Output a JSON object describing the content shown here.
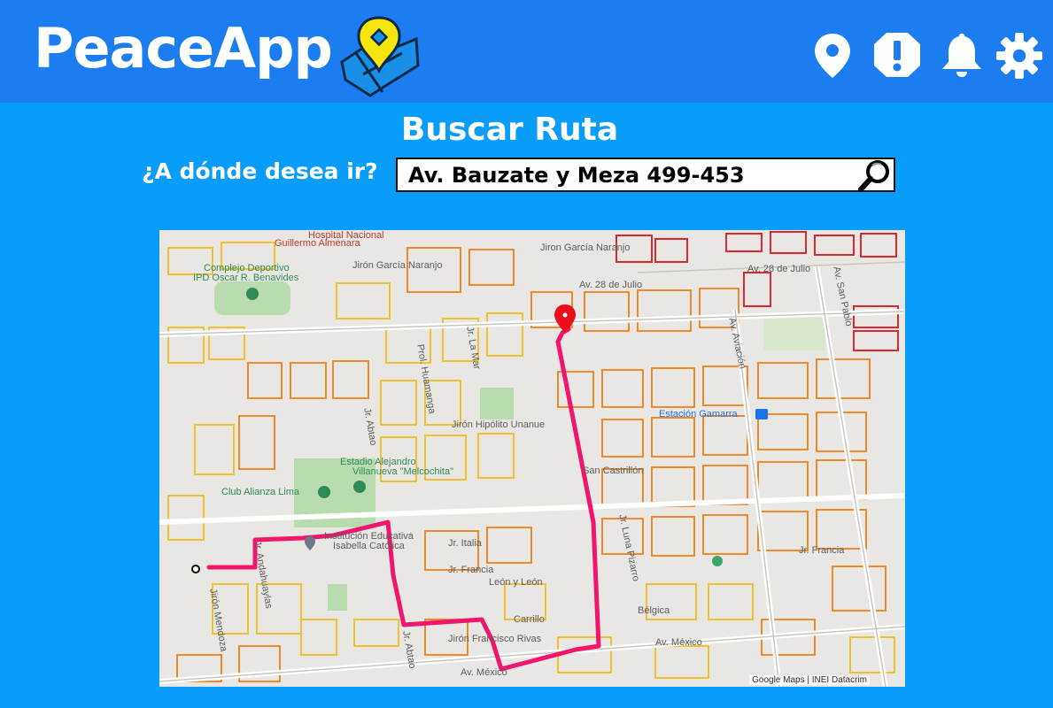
{
  "app": {
    "name": "PeaceApp"
  },
  "header": {
    "icons": [
      "location-icon",
      "alert-icon",
      "bell-icon",
      "gear-icon"
    ]
  },
  "page": {
    "title": "Buscar Ruta",
    "prompt": "¿A dónde desea ir?"
  },
  "search": {
    "value": "Av. Bauzate y Meza 499-453"
  },
  "colors": {
    "header_bg": "#1b7df0",
    "page_bg": "#0a9cf9",
    "route": "#f0166e",
    "destination_pin": "#e8101a",
    "logo_yellow": "#f5e50a"
  },
  "map": {
    "labels": {
      "hospital": "Hospital Nacional",
      "hospital2": "Guillermo Almenara",
      "complejo": "Complejo Deportivo",
      "ipd": "IPD Oscar R. Benavides",
      "garcia": "Jirón García Naranjo",
      "garcia2": "Jiron García Naranjo",
      "julio1": "Av. 28 de Julio",
      "julio2": "Av. 28 de Julio",
      "huamanga": "Prol. Huamanga",
      "lamar": "Jr. La Mar",
      "hipolito": "Jirón Hipólito Unanue",
      "estadio": "Estadio Alejandro",
      "estadio2": "Villanueva \"Melcochita\"",
      "alianza": "Club Alianza Lima",
      "institucion": "Institución Educativa",
      "institucion2": "Isabella Católica",
      "italia": "Jr. Italia",
      "francia": "Jr. Francia",
      "leon": "León y León",
      "carrillo": "Carrillo",
      "rivas": "Jirón Francisco Rivas",
      "mexico1": "Av. México",
      "mexico2": "Av. México",
      "gamarra": "Estación Gamarra",
      "aviacion": "Av. Aviación",
      "sanpablo": "Av. San Pablo",
      "castrillon": "San Castrillón",
      "francia2": "Jr. Francia",
      "belgica": "Bélgica",
      "abtao": "Jr. Abtao",
      "abtao2": "Jr. Abtao",
      "mendoza": "Jirón Mendoza",
      "andahuaylas": "Jr. Andahuaylas",
      "luna": "Jr. Luna Pizarro",
      "google": "Google Maps | INEI Datacrim"
    }
  }
}
